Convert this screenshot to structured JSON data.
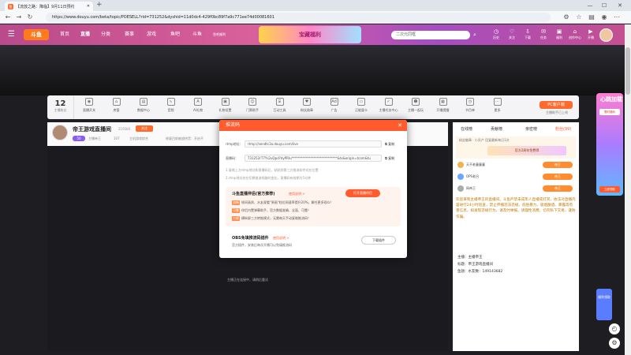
{
  "browser": {
    "tab_title": "【流放之路：降临】9月11日预约",
    "url": "https://www.douyu.com/beta/topic/POESELL?rid=731252&dyshid=11d0dc4-429f0bc89f7a9c771ee74d00081601"
  },
  "site_header": {
    "logo": "斗鱼",
    "nav": [
      "首页",
      "直播",
      "分类",
      "赛事",
      "游戏",
      "鱼吧",
      "斗鱼"
    ],
    "mini_text": "鱼吧福利",
    "banner_text": "宝藏福利",
    "search_placeholder": "二次元同框",
    "icons": [
      {
        "icon": "history-icon",
        "label": "历史"
      },
      {
        "icon": "follow-icon",
        "label": "关注"
      },
      {
        "icon": "download-icon",
        "label": "下载"
      },
      {
        "icon": "task-icon",
        "label": "任务"
      },
      {
        "icon": "gift-icon",
        "label": "福利"
      },
      {
        "icon": "dashboard-icon",
        "label": "创作中心"
      },
      {
        "icon": "live-icon",
        "label": "开播"
      }
    ]
  },
  "toolbar": {
    "follow_count": "12",
    "follow_label": "主播粉丝",
    "tools": [
      {
        "icon": "live-open-icon",
        "label": "直播开关"
      },
      {
        "icon": "room-icon",
        "label": "房管"
      },
      {
        "icon": "data-icon",
        "label": "数据中心"
      },
      {
        "icon": "wave-icon",
        "label": "音频"
      },
      {
        "icon": "ai-icon",
        "label": "AI礼物"
      },
      {
        "icon": "gift-box-icon",
        "label": "礼物设置"
      },
      {
        "icon": "robot-icon",
        "label": "门票助手"
      },
      {
        "icon": "shop-icon",
        "label": "互动工具"
      },
      {
        "icon": "fan-icon",
        "label": "粉丝勋章"
      },
      {
        "icon": "ad-icon",
        "label": "广告"
      },
      {
        "icon": "card-icon",
        "label": "正能量卡"
      },
      {
        "icon": "check-icon",
        "label": "主播任务中心"
      },
      {
        "icon": "user-icon",
        "label": "主播一起玩"
      },
      {
        "icon": "calendar-icon",
        "label": "开播提醒"
      },
      {
        "icon": "clock-icon",
        "label": "节目单"
      },
      {
        "icon": "more-icon",
        "label": "更多"
      }
    ],
    "pc_client": "PC客户端",
    "pc_sub": "主播助手已上线"
  },
  "room": {
    "title": "帝王游戏直播间",
    "room_id": "219384",
    "subscribe": "关注",
    "level": "50",
    "streamer": "主播帝王",
    "fans": "107",
    "category": "主机游戏综合",
    "extra": "修复目前被放拼音：开启不",
    "status": "主播正在连接中，请稍后重试"
  },
  "dialog": {
    "title": "推流码",
    "rtmp_label": "rtmp地址：",
    "rtmp_value": "rtmp://sendtc3a.douyu.com/live",
    "key_label": "直播码：",
    "key_value": "731252rT7Ys2uQpd?dyPRIu*****************************&tx&origin=tcom&tu",
    "copy": "复制",
    "notes": [
      "1.复制上方rtmp地址和直播码后，粘贴到第三方推流软件对应位置",
      "2.rtmp地址仅在切换推流线路时变化，直播码有效期为5分钟"
    ],
    "assistant": {
      "title": "斗鱼直播伴侣(官方推荐)",
      "link": "使用说明 >",
      "open": "打开直播伴侣",
      "features": [
        {
          "tag": "流畅",
          "text": "帧间画质、水友观看\"原画\"档位网速率提升20%，解任更多观众！"
        },
        {
          "tag": "可靠",
          "text": "伴侣内置弹幕助手，官方数据准确、全面、可靠！"
        },
        {
          "tag": "方便",
          "text": "横纵屏三方转推模式，无需每天手动复制推流码！"
        }
      ]
    },
    "obs": {
      "title": "OBS免填推流码插件",
      "link": "使用说明 >",
      "desc": "官方插件，安装后每次开播可以免填推流码",
      "download": "下载插件"
    }
  },
  "chat": {
    "tabs": [
      "在线榜",
      "贡献榜",
      "亲密榜",
      "粉丝(99)"
    ],
    "rank_title": "粉丝徽章  ·  小贡产  回复最新每日1次",
    "rank_banner": "官方2周年免费得",
    "rows": [
      {
        "name": "天不老童童童",
        "tag": "帝王"
      },
      {
        "name": "OPS老吕",
        "tag": "帝王"
      },
      {
        "name": "网帝王",
        "tag": "帝王"
      }
    ],
    "notice": "欢迎来到主播帝王的直播间。斗鱼严禁未成年人直播或打赏，依法对直播内容进行24小时巡查，禁止传播违法违规、低俗暴力、吸烟酗酒、暴露等有害信息，如发现违规行为，请及时举报。请理性消费，切勿私下交易，谨防诈骗。",
    "info": [
      "主播：主播帝王",
      "标题：帝王游戏直播间",
      "鱼翅：水友数：149143682"
    ]
  },
  "side": {
    "ad_title": "心跳加载",
    "ad_btn": "限时福利",
    "ad_btn2": "立即领取",
    "ad2": "福利领取"
  }
}
